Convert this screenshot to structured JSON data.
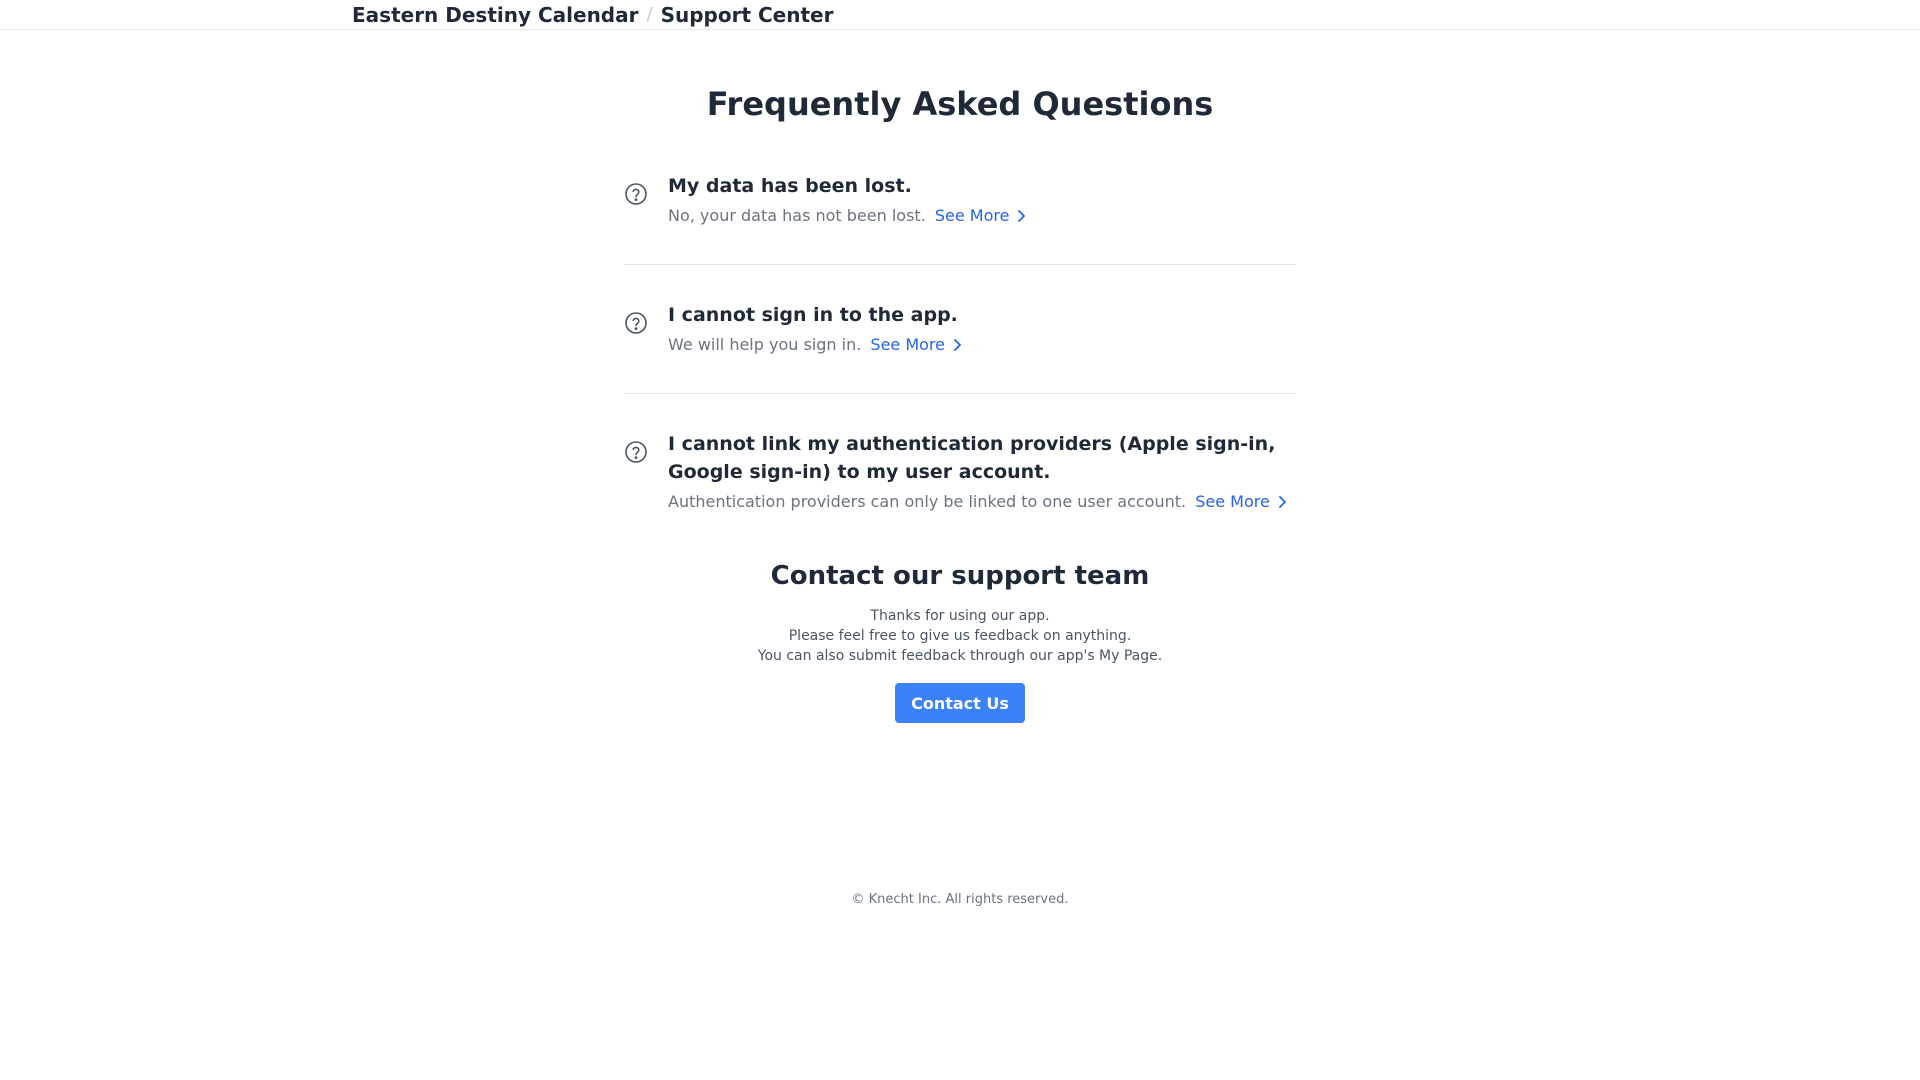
{
  "header": {
    "app_name": "Eastern Destiny Calendar",
    "separator": "/",
    "section": "Support Center"
  },
  "faq": {
    "title": "Frequently Asked Questions",
    "see_more_label": "See More",
    "items": [
      {
        "icon": "question-circle-icon",
        "question": "My data has been lost.",
        "answer": "No, your data has not been lost."
      },
      {
        "icon": "question-circle-icon",
        "question": "I cannot sign in to the app.",
        "answer": "We will help you sign in."
      },
      {
        "icon": "question-circle-icon",
        "question": "I cannot link my authentication providers (Apple sign-in, Google sign-in) to my user account.",
        "answer": "Authentication providers can only be linked to one user account."
      }
    ]
  },
  "contact": {
    "title": "Contact our support team",
    "lines": [
      "Thanks for using our app.",
      "Please feel free to give us feedback on anything.",
      "You can also submit feedback through our app's My Page."
    ],
    "button_label": "Contact Us"
  },
  "footer": {
    "copyright": "© Knecht Inc. All rights reserved."
  },
  "colors": {
    "accent": "#3b82f6",
    "link": "#2563eb",
    "text_primary": "#1f2937",
    "text_muted": "#6b7280"
  }
}
